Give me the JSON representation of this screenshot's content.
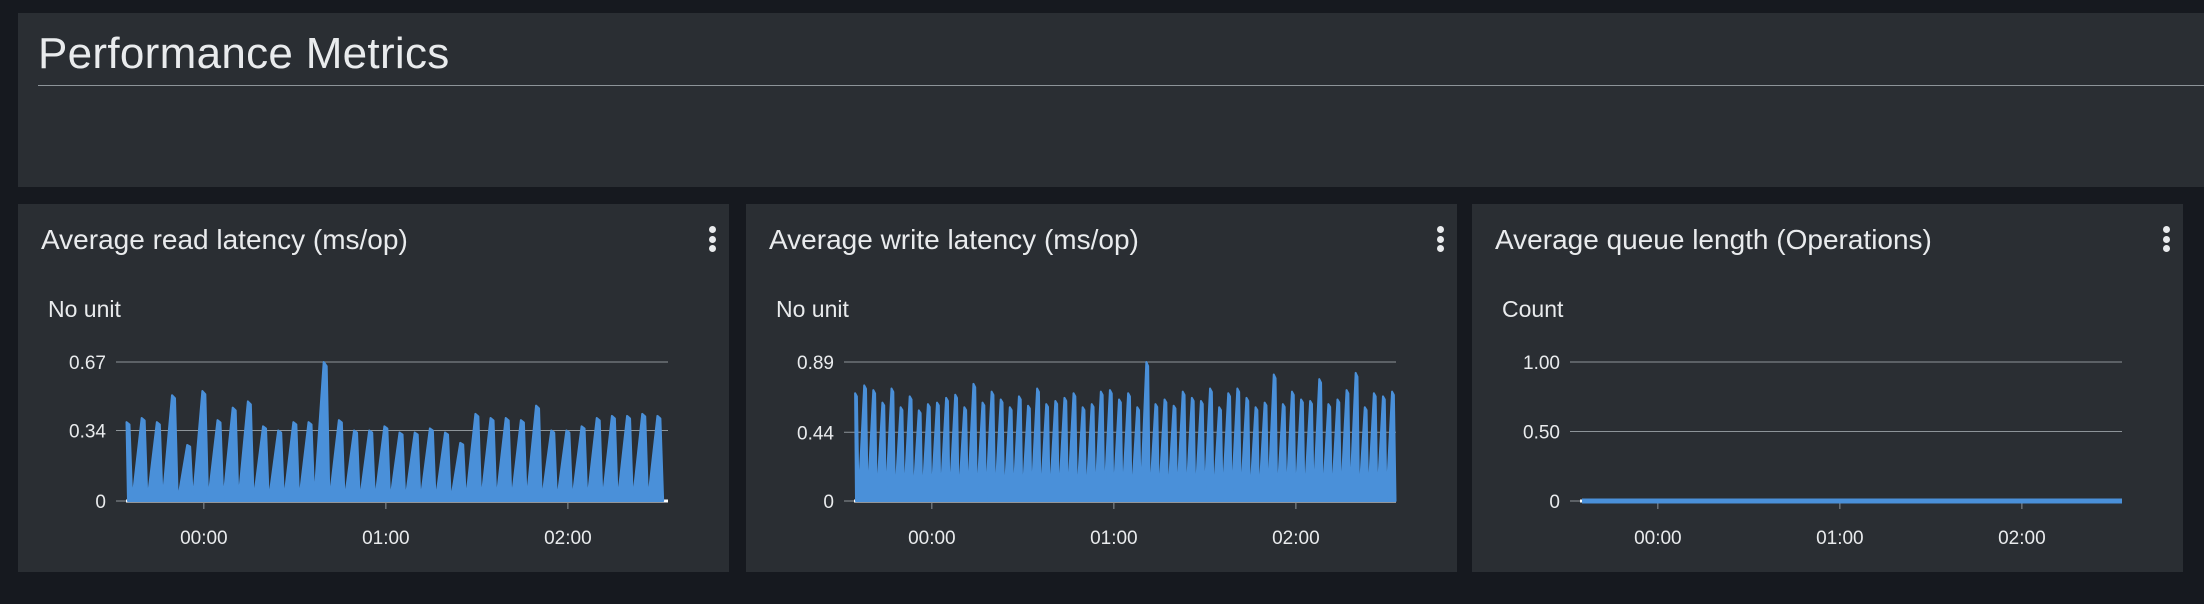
{
  "dashboard": {
    "title": "Performance Metrics"
  },
  "colors": {
    "background": "#16191f",
    "panel": "#2a2e33",
    "series": "#4a90d9",
    "grid": "#8d9499",
    "text": "#e9ebed"
  },
  "widgets": [
    {
      "title": "Average read latency (ms/op)",
      "unit_label": "No unit",
      "menu_icon": "kebab-menu-icon"
    },
    {
      "title": "Average write latency (ms/op)",
      "unit_label": "No unit",
      "menu_icon": "kebab-menu-icon"
    },
    {
      "title": "Average queue length (Operations)",
      "unit_label": "Count",
      "menu_icon": "kebab-menu-icon"
    }
  ],
  "chart_data": [
    {
      "type": "area",
      "title": "Average read latency (ms/op)",
      "ylabel": "No unit",
      "xlabel": "",
      "ylim": [
        0,
        0.67
      ],
      "y_ticks": [
        "0",
        "0.34",
        "0.67"
      ],
      "x_ticks": [
        "00:00",
        "01:00",
        "02:00"
      ],
      "x_range": [
        "23:35",
        "02:33"
      ],
      "grid": true,
      "series": [
        {
          "x": [
            "23:35",
            "23:40",
            "23:45",
            "23:50",
            "23:55",
            "00:00",
            "00:05",
            "00:10",
            "00:15",
            "00:20",
            "00:25",
            "00:30",
            "00:35",
            "00:40",
            "00:45",
            "00:50",
            "00:55",
            "01:00",
            "01:05",
            "01:10",
            "01:15",
            "01:20",
            "01:25",
            "01:30",
            "01:35",
            "01:40",
            "01:45",
            "01:50",
            "01:55",
            "02:00",
            "02:05",
            "02:10",
            "02:15",
            "02:20",
            "02:25",
            "02:30"
          ],
          "values": [
            0.38,
            0.4,
            0.38,
            0.51,
            0.27,
            0.53,
            0.39,
            0.45,
            0.48,
            0.36,
            0.34,
            0.38,
            0.38,
            0.67,
            0.39,
            0.34,
            0.34,
            0.36,
            0.33,
            0.33,
            0.35,
            0.33,
            0.28,
            0.42,
            0.4,
            0.4,
            0.39,
            0.46,
            0.34,
            0.34,
            0.36,
            0.4,
            0.41,
            0.41,
            0.42,
            0.41
          ]
        }
      ]
    },
    {
      "type": "area",
      "title": "Average write latency (ms/op)",
      "ylabel": "No unit",
      "xlabel": "",
      "ylim": [
        0,
        0.89
      ],
      "y_ticks": [
        "0",
        "0.44",
        "0.89"
      ],
      "x_ticks": [
        "00:00",
        "01:00",
        "02:00"
      ],
      "x_range": [
        "23:35",
        "02:33"
      ],
      "grid": true,
      "series": [
        {
          "x": [
            "23:35",
            "23:38",
            "23:41",
            "23:44",
            "23:47",
            "23:50",
            "23:53",
            "23:56",
            "23:59",
            "00:02",
            "00:05",
            "00:08",
            "00:11",
            "00:14",
            "00:17",
            "00:20",
            "00:23",
            "00:26",
            "00:29",
            "00:32",
            "00:35",
            "00:38",
            "00:41",
            "00:44",
            "00:47",
            "00:50",
            "00:53",
            "00:56",
            "00:59",
            "01:02",
            "01:05",
            "01:08",
            "01:11",
            "01:14",
            "01:17",
            "01:20",
            "01:23",
            "01:26",
            "01:29",
            "01:32",
            "01:35",
            "01:38",
            "01:41",
            "01:44",
            "01:47",
            "01:50",
            "01:53",
            "01:56",
            "01:59",
            "02:02",
            "02:05",
            "02:08",
            "02:11",
            "02:14",
            "02:17",
            "02:20",
            "02:23",
            "02:26",
            "02:29",
            "02:32"
          ],
          "values": [
            0.69,
            0.74,
            0.71,
            0.63,
            0.72,
            0.6,
            0.67,
            0.58,
            0.62,
            0.63,
            0.66,
            0.68,
            0.6,
            0.75,
            0.63,
            0.7,
            0.65,
            0.6,
            0.67,
            0.61,
            0.72,
            0.62,
            0.64,
            0.66,
            0.69,
            0.6,
            0.62,
            0.7,
            0.71,
            0.65,
            0.69,
            0.6,
            0.89,
            0.62,
            0.65,
            0.61,
            0.7,
            0.66,
            0.64,
            0.72,
            0.6,
            0.69,
            0.72,
            0.66,
            0.6,
            0.63,
            0.81,
            0.62,
            0.7,
            0.65,
            0.64,
            0.78,
            0.62,
            0.65,
            0.71,
            0.82,
            0.6,
            0.69,
            0.67,
            0.7
          ]
        }
      ]
    },
    {
      "type": "line",
      "title": "Average queue length (Operations)",
      "ylabel": "Count",
      "xlabel": "",
      "ylim": [
        0,
        1.0
      ],
      "y_ticks": [
        "0",
        "0.50",
        "1.00"
      ],
      "x_ticks": [
        "00:00",
        "01:00",
        "02:00"
      ],
      "x_range": [
        "23:35",
        "02:33"
      ],
      "grid": true,
      "series": [
        {
          "x": [
            "23:35",
            "00:00",
            "00:30",
            "01:00",
            "01:30",
            "02:00",
            "02:33"
          ],
          "values": [
            0,
            0,
            0,
            0,
            0,
            0,
            0
          ]
        }
      ]
    }
  ]
}
